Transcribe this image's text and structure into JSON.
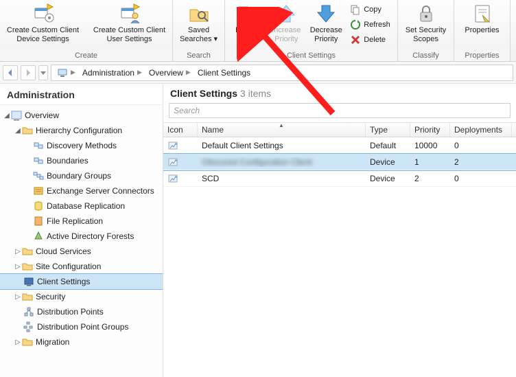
{
  "ribbon": {
    "groups": {
      "create": {
        "label": "Create",
        "custom_device": "Create Custom Client Device Settings",
        "custom_user": "Create Custom Client User Settings"
      },
      "search": {
        "label": "Search",
        "saved_searches": "Saved Searches ▾"
      },
      "client_settings": {
        "label": "Client Settings",
        "deploy": "Deploy",
        "inc_priority": "Increase Priority",
        "dec_priority": "Decrease Priority",
        "copy": "Copy",
        "refresh": "Refresh",
        "delete": "Delete"
      },
      "classify": {
        "label": "Classify",
        "scopes": "Set Security Scopes"
      },
      "properties": {
        "label": "Properties",
        "properties": "Properties"
      }
    }
  },
  "breadcrumb": {
    "root": "",
    "administration": "Administration",
    "overview": "Overview",
    "client_settings": "Client Settings"
  },
  "nav": {
    "header": "Administration",
    "overview": "Overview",
    "hierarchy": "Hierarchy Configuration",
    "discovery": "Discovery Methods",
    "boundaries": "Boundaries",
    "boundary_groups": "Boundary Groups",
    "exchange": "Exchange Server Connectors",
    "db_replication": "Database Replication",
    "file_replication": "File Replication",
    "ad_forests": "Active Directory Forests",
    "cloud": "Cloud Services",
    "site_config": "Site Configuration",
    "client_settings": "Client Settings",
    "security": "Security",
    "dist_points": "Distribution Points",
    "dist_point_groups": "Distribution Point Groups",
    "migration": "Migration"
  },
  "pane": {
    "title": "Client Settings",
    "count": "3 items",
    "search_placeholder": "Search"
  },
  "grid": {
    "columns": {
      "icon": "Icon",
      "name": "Name",
      "type": "Type",
      "priority": "Priority",
      "deployments": "Deployments"
    },
    "rows": [
      {
        "name": "Default Client Settings",
        "type": "Default",
        "priority": "10000",
        "deployments": "0",
        "blurred": false,
        "selected": false
      },
      {
        "name": "Obscured Configuration Client",
        "type": "Device",
        "priority": "1",
        "deployments": "2",
        "blurred": true,
        "selected": true
      },
      {
        "name": "SCD",
        "type": "Device",
        "priority": "2",
        "deployments": "0",
        "blurred": false,
        "selected": false
      }
    ]
  }
}
